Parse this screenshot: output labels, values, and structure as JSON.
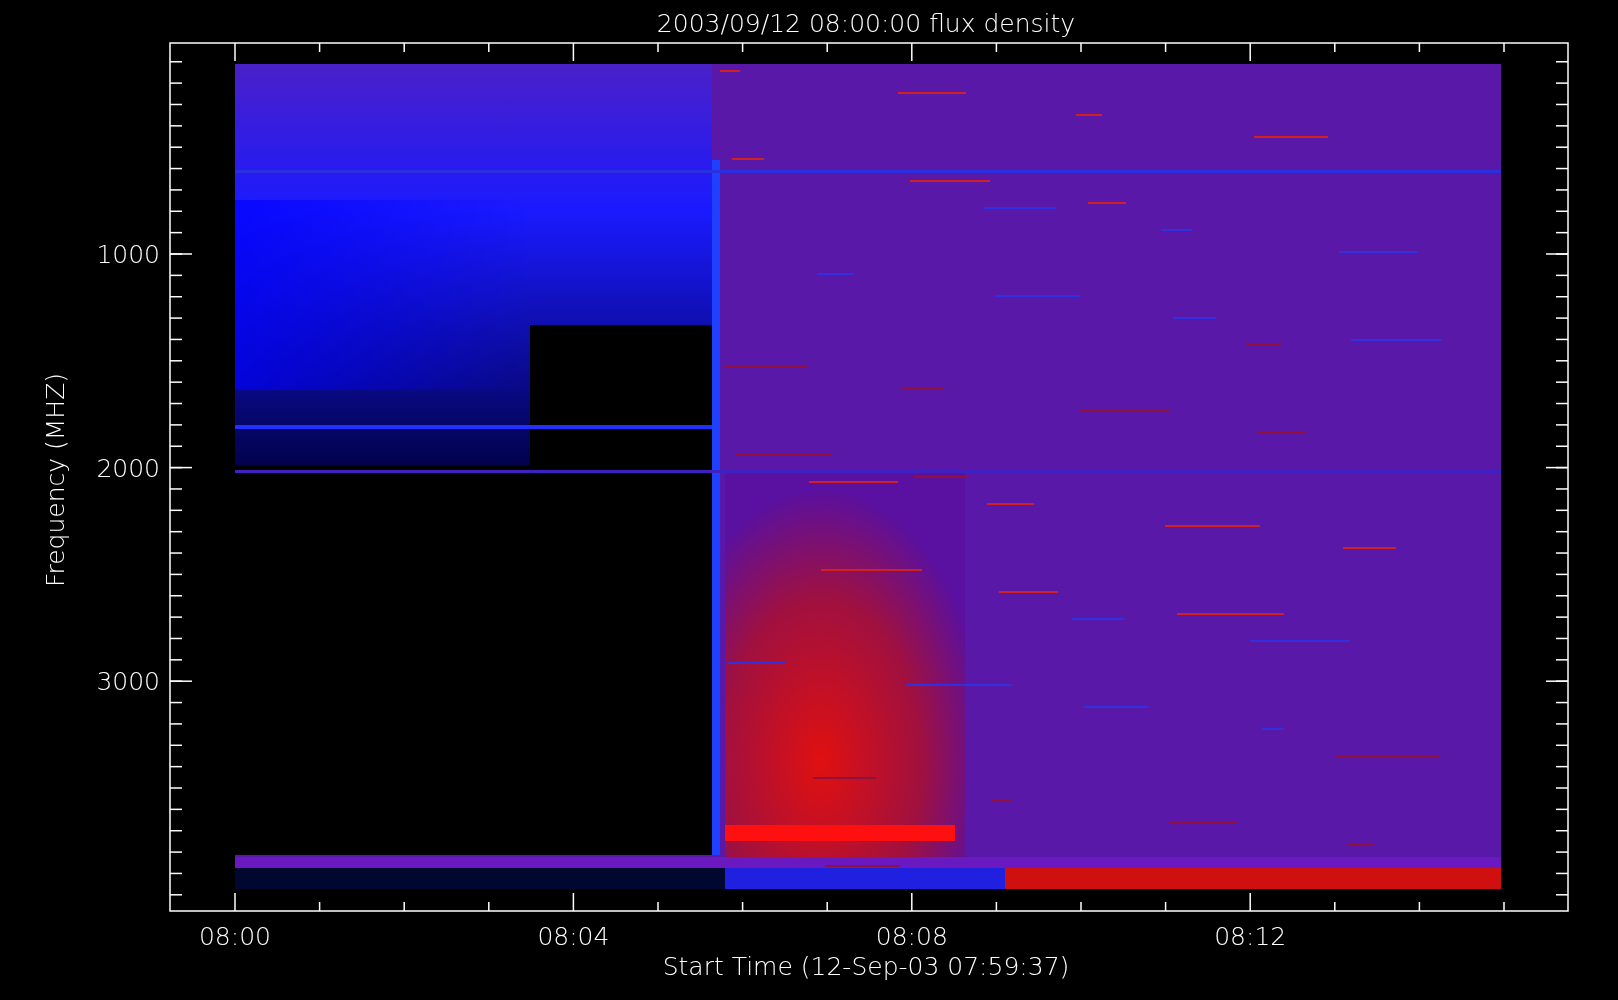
{
  "plot": {
    "title": "2003/09/12 08:00:00 flux density",
    "xlabel": "Start Time (12-Sep-03 07:59:37)",
    "ylabel": "Frequency (MHZ)",
    "xticks": [
      "08:00",
      "08:04",
      "08:08",
      "08:12"
    ],
    "yticks": [
      "1000",
      "2000",
      "3000"
    ]
  }
}
